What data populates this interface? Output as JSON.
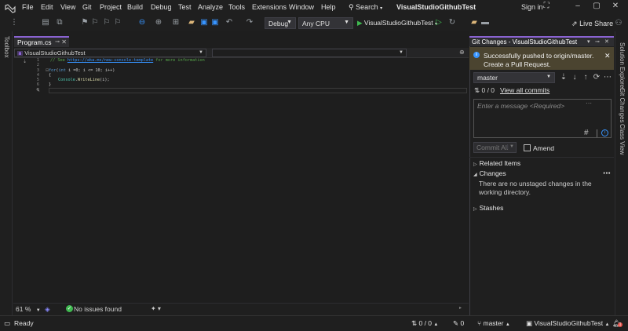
{
  "menubar": {
    "items": [
      "File",
      "Edit",
      "View",
      "Git",
      "Project",
      "Build",
      "Debug",
      "Test",
      "Analyze",
      "Tools",
      "Extensions",
      "Window",
      "Help"
    ],
    "search_label": "Search",
    "project_title": "VisualStudioGithubTest",
    "signin_label": "Sign in"
  },
  "toolbar": {
    "config": "Debug",
    "platform": "Any CPU",
    "run_target": "VisualStudioGithubTest",
    "live_share": "Live Share"
  },
  "side_rails": {
    "left": [
      "Toolbox"
    ],
    "right": [
      "Solution Explorer",
      "Git Changes",
      "Class View"
    ]
  },
  "editor": {
    "tab_title": "Program.cs",
    "nav_scope": "VisualStudioGithubTest",
    "line_numbers": [
      "1",
      "2",
      "3",
      "4",
      "5",
      "6",
      "7"
    ],
    "code": {
      "l1_comment_pre": "// See ",
      "l1_link": "https://aka.ms/new-console-template",
      "l1_comment_post": " for more information",
      "l3_for": "for",
      "l3_int": "int",
      "l3_rest": " i =0; i <= 10; i++)",
      "l4": "{",
      "l5_console": "Console",
      "l5_dot": ".",
      "l5_method": "WriteLine",
      "l5_args": "(i);",
      "l6": "}"
    },
    "zoom": "61 %",
    "issues": "No issues found"
  },
  "git_changes": {
    "title": "Git Changes - VisualStudioGithubTest",
    "banner_message": "Successfully pushed to origin/master.",
    "banner_link": "Create a Pull Request.",
    "branch": "master",
    "commits_count": "0 / 0",
    "view_all_commits": "View all commits",
    "message_placeholder": "Enter a message <Required>",
    "commit_all": "Commit All",
    "amend": "Amend",
    "related_items": "Related Items",
    "changes": "Changes",
    "no_changes_text": "There are no unstaged changes in the working directory.",
    "stashes": "Stashes"
  },
  "statusbar": {
    "ready": "Ready",
    "sync_count": "0 / 0",
    "pending_edits": "0",
    "branch": "master",
    "repo": "VisualStudioGithubTest",
    "notifications": "1"
  },
  "colors": {
    "accent": "#8a63d2",
    "banner_bg": "#4b4430",
    "info_blue": "#3794ff",
    "success_green": "#3fb950"
  }
}
